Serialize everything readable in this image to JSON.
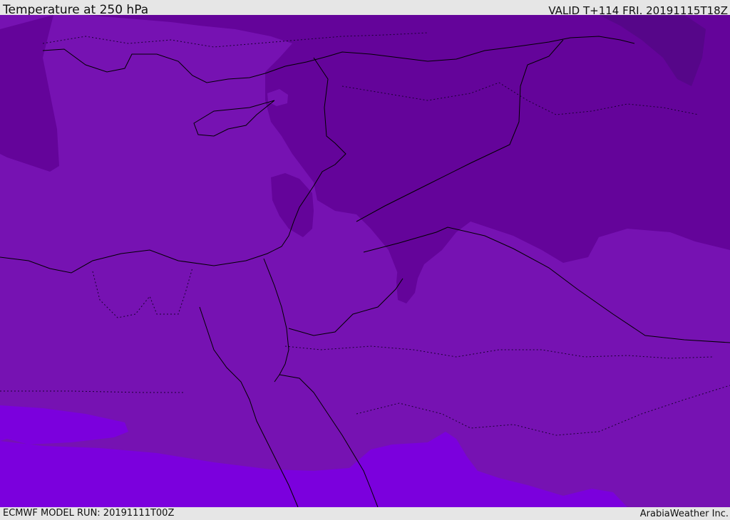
{
  "header": {
    "title": "Temperature at 250 hPa",
    "valid": "VALID T+114 FRI. 20191115T18Z"
  },
  "footer": {
    "model_run": "ECMWF MODEL RUN: 20191111T00Z",
    "credit": "ArabiaWeather Inc."
  },
  "map": {
    "field_colors": {
      "base": "#7612b2",
      "cold": "#64049a",
      "colder": "#560689",
      "warm": "#7b00dd"
    },
    "border_color": "#000000"
  }
}
